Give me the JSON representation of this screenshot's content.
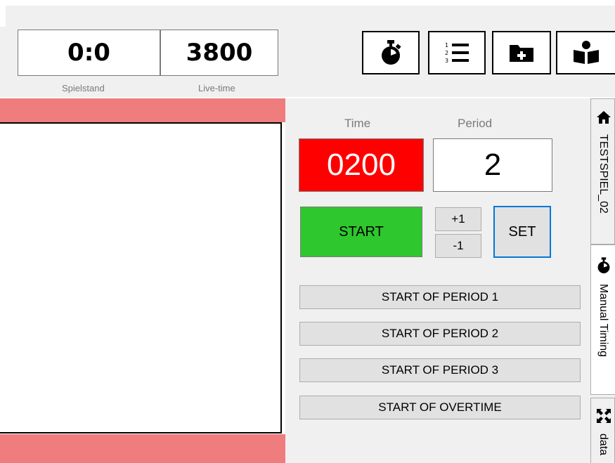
{
  "header": {
    "score_value": "0:0",
    "score_caption": "Spielstand",
    "live_value": "3800",
    "live_caption": "Live-time"
  },
  "toolbar": {
    "buttons": [
      {
        "icon": "stopwatch-icon"
      },
      {
        "icon": "numbered-list-icon"
      },
      {
        "icon": "folder-plus-icon"
      },
      {
        "icon": "reader-icon"
      }
    ]
  },
  "timing": {
    "time_label": "Time",
    "period_label": "Period",
    "time_value": "0200",
    "period_value": "2",
    "start_label": "START",
    "plus_label": "+1",
    "minus_label": "-1",
    "set_label": "SET",
    "period_buttons": [
      "START OF PERIOD 1",
      "START OF PERIOD 2",
      "START OF PERIOD 3",
      "START OF OVERTIME"
    ]
  },
  "tabs": [
    {
      "icon": "home-icon",
      "label": "TESTSPIEL_02"
    },
    {
      "icon": "stopwatch-icon",
      "label": "Manual Timing"
    },
    {
      "icon": "expand-icon",
      "label": "data"
    }
  ],
  "colors": {
    "time_bg": "#ff0000",
    "start_bg": "#2ec82e",
    "salmon_bar": "#ef7d7d",
    "set_border": "#0078d7"
  }
}
